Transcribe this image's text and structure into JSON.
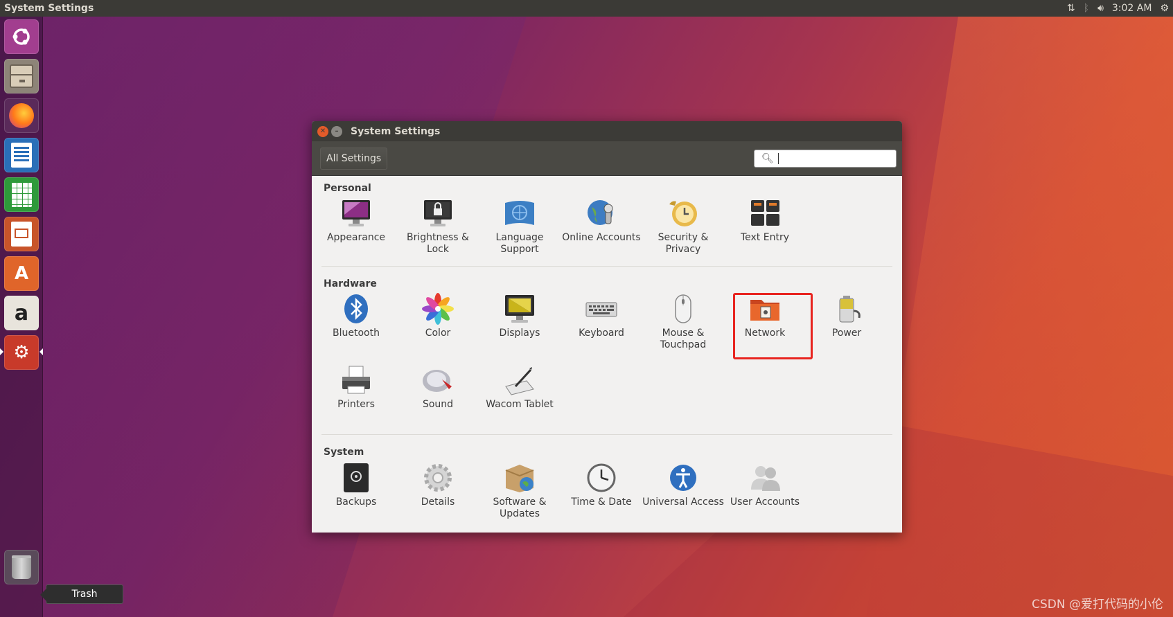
{
  "top_panel": {
    "app_title": "System Settings",
    "time": "3:02 AM",
    "icons": [
      "network-arrows-icon",
      "bluetooth-icon",
      "volume-icon",
      "gear-icon"
    ]
  },
  "launcher": {
    "items": [
      {
        "name": "ubuntu-dash",
        "color": "#a23e8f"
      },
      {
        "name": "files",
        "color": "#b5a48a"
      },
      {
        "name": "firefox",
        "color": "#e66000"
      },
      {
        "name": "libreoffice-writer",
        "color": "#2a6fb8"
      },
      {
        "name": "libreoffice-calc",
        "color": "#2e9a3a"
      },
      {
        "name": "libreoffice-impress",
        "color": "#c8542a"
      },
      {
        "name": "ubuntu-software",
        "color": "#e0652a"
      },
      {
        "name": "amazon",
        "color": "#e8e4dc"
      },
      {
        "name": "system-settings",
        "color": "#c83a2a"
      },
      {
        "name": "trash",
        "color": "#6c6c6c"
      }
    ],
    "trash_tooltip": "Trash"
  },
  "window": {
    "title": "System Settings",
    "all_settings_label": "All Settings",
    "search_placeholder": "",
    "sections": [
      {
        "title": "Personal",
        "items": [
          {
            "label": "Appearance",
            "icon": "appearance-icon"
          },
          {
            "label": "Brightness & Lock",
            "icon": "brightness-lock-icon"
          },
          {
            "label": "Language Support",
            "icon": "language-support-icon"
          },
          {
            "label": "Online Accounts",
            "icon": "online-accounts-icon"
          },
          {
            "label": "Security & Privacy",
            "icon": "security-privacy-icon"
          },
          {
            "label": "Text Entry",
            "icon": "text-entry-icon"
          }
        ]
      },
      {
        "title": "Hardware",
        "items": [
          {
            "label": "Bluetooth",
            "icon": "bluetooth-icon"
          },
          {
            "label": "Color",
            "icon": "color-icon"
          },
          {
            "label": "Displays",
            "icon": "displays-icon"
          },
          {
            "label": "Keyboard",
            "icon": "keyboard-icon"
          },
          {
            "label": "Mouse & Touchpad",
            "icon": "mouse-touchpad-icon"
          },
          {
            "label": "Network",
            "icon": "network-icon"
          },
          {
            "label": "Power",
            "icon": "power-icon"
          },
          {
            "label": "Printers",
            "icon": "printers-icon"
          },
          {
            "label": "Sound",
            "icon": "sound-icon"
          },
          {
            "label": "Wacom Tablet",
            "icon": "wacom-tablet-icon"
          }
        ]
      },
      {
        "title": "System",
        "items": [
          {
            "label": "Backups",
            "icon": "backups-icon"
          },
          {
            "label": "Details",
            "icon": "details-icon"
          },
          {
            "label": "Software & Updates",
            "icon": "software-updates-icon"
          },
          {
            "label": "Time & Date",
            "icon": "time-date-icon"
          },
          {
            "label": "Universal Access",
            "icon": "universal-access-icon"
          },
          {
            "label": "User Accounts",
            "icon": "user-accounts-icon"
          }
        ]
      }
    ]
  },
  "watermark": "CSDN @爱打代码的小伦"
}
